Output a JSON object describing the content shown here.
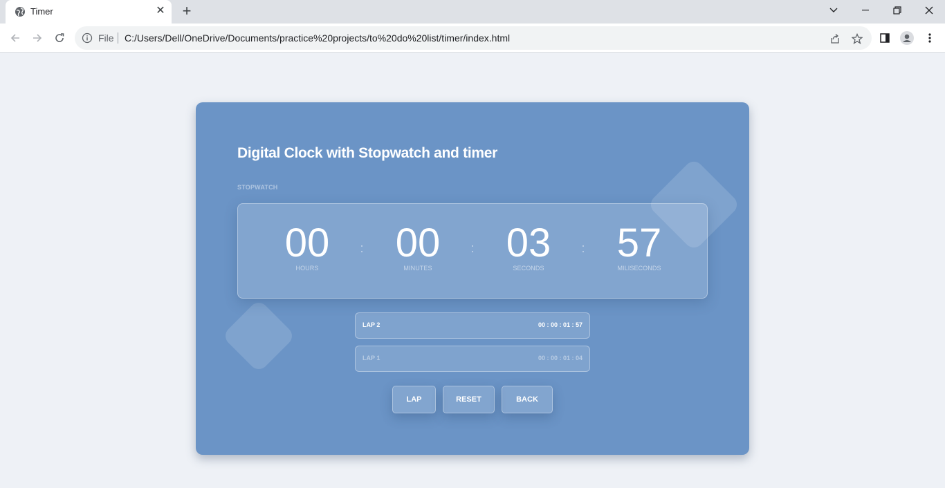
{
  "browser": {
    "tab": {
      "title": "Timer"
    },
    "address": {
      "scheme": "File",
      "url": "C:/Users/Dell/OneDrive/Documents/practice%20projects/to%20do%20list/timer/index.html"
    }
  },
  "page": {
    "title": "Digital Clock with Stopwatch and timer",
    "section_label": "STOPWATCH",
    "clock": {
      "hours": {
        "value": "00",
        "label": "HOURS"
      },
      "minutes": {
        "value": "00",
        "label": "MINUTES"
      },
      "seconds": {
        "value": "03",
        "label": "SECONDS"
      },
      "milliseconds": {
        "value": "57",
        "label": "MILISECONDS"
      },
      "separator": ":"
    },
    "laps": [
      {
        "name": "LAP 2",
        "time": "00 : 00 : 01 : 57"
      },
      {
        "name": "LAP 1",
        "time": "00 : 00 : 01 : 04"
      }
    ],
    "buttons": {
      "lap": "LAP",
      "reset": "RESET",
      "back": "BACK"
    }
  },
  "colors": {
    "page_bg": "#eef1f6",
    "card_bg": "#6b94c6",
    "text": "#ffffff"
  }
}
